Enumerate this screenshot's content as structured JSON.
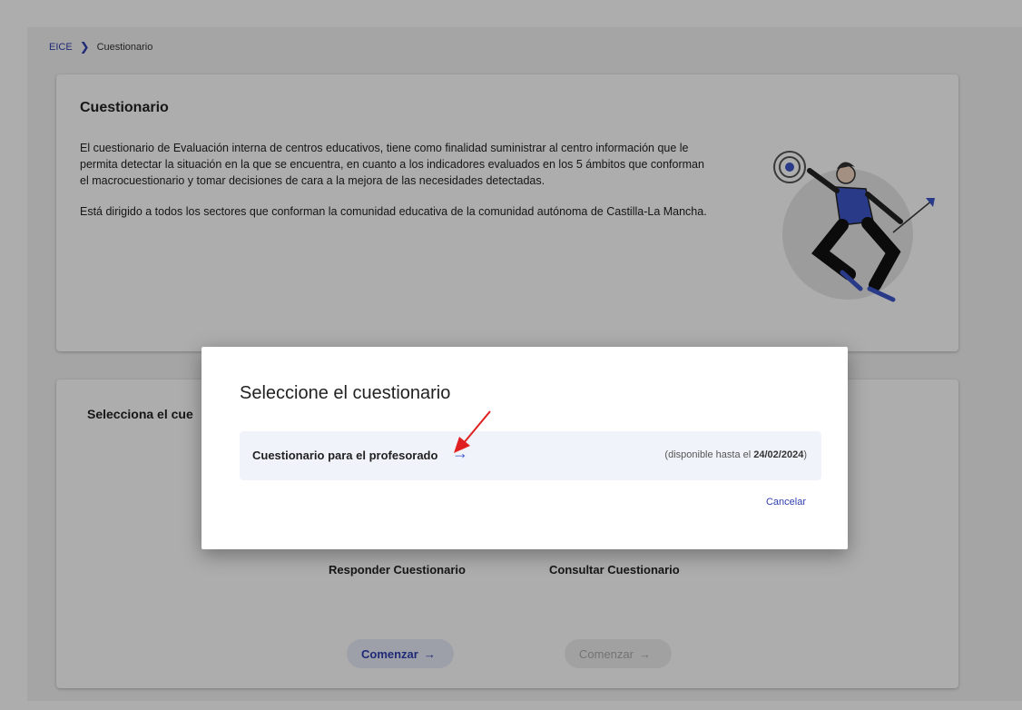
{
  "breadcrumb": {
    "root": "EICE",
    "current": "Cuestionario"
  },
  "intro": {
    "title": "Cuestionario",
    "paragraph1": "El cuestionario de Evaluación interna de centros educativos, tiene como finalidad suministrar al centro información que le permita detectar la situación en la que se encuentra, en cuanto a los indicadores evaluados en los 5 ámbitos que conforman el macrocuestionario y tomar decisiones de cara a la mejora de las necesidades detectadas.",
    "paragraph2": "Está dirigido a todos los sectores que conforman la comunidad educativa de la comunidad autónoma de Castilla-La Mancha."
  },
  "select_card": {
    "title": "Selecciona el cue",
    "options": [
      {
        "label": "Responder Cuestionario",
        "button": "Comenzar",
        "button_icon": "→"
      },
      {
        "label": "Consultar Cuestionario",
        "button": "Comenzar",
        "button_icon": "→"
      }
    ]
  },
  "modal": {
    "title": "Seleccione el cuestionario",
    "item": {
      "label": "Cuestionario para el profesorado",
      "arrow": "→",
      "availability_prefix": "(disponible hasta el ",
      "availability_date": "24/02/2024",
      "availability_suffix": ")"
    },
    "cancel": "Cancelar"
  },
  "colors": {
    "accent": "#2f3fb0",
    "annotation": "#e02020",
    "illustration_shirt": "#3d56c9"
  },
  "icons": {
    "breadcrumb_separator": "chevron-right-icon",
    "item_arrow": "arrow-right-icon",
    "button_arrow": "arrow-right-icon",
    "annotation": "red-arrow-annotation"
  }
}
